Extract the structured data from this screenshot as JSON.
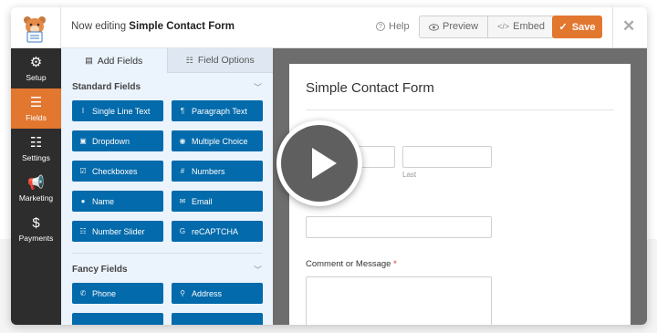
{
  "header": {
    "editing_prefix": "Now editing",
    "form_name": "Simple Contact Form",
    "help": "Help",
    "preview": "Preview",
    "embed": "Embed",
    "save": "Save"
  },
  "nav": [
    {
      "label": "Setup",
      "icon": "gear-icon"
    },
    {
      "label": "Fields",
      "icon": "fields-icon"
    },
    {
      "label": "Settings",
      "icon": "sliders-icon"
    },
    {
      "label": "Marketing",
      "icon": "megaphone-icon"
    },
    {
      "label": "Payments",
      "icon": "dollar-icon"
    }
  ],
  "tabs": {
    "add_fields": "Add Fields",
    "field_options": "Field Options"
  },
  "standard_fields": {
    "title": "Standard Fields",
    "items": [
      "Single Line Text",
      "Paragraph Text",
      "Dropdown",
      "Multiple Choice",
      "Checkboxes",
      "Numbers",
      "Name",
      "Email",
      "Number Slider",
      "reCAPTCHA"
    ]
  },
  "fancy_fields": {
    "title": "Fancy Fields",
    "items": [
      "Phone",
      "Address"
    ]
  },
  "form": {
    "title": "Simple Contact Form",
    "last_label": "Last",
    "comment_label": "Comment or Message",
    "required_mark": "*"
  },
  "colors": {
    "accent": "#e27730",
    "field_button": "#036aab",
    "nav_bg": "#2d2d2d"
  }
}
